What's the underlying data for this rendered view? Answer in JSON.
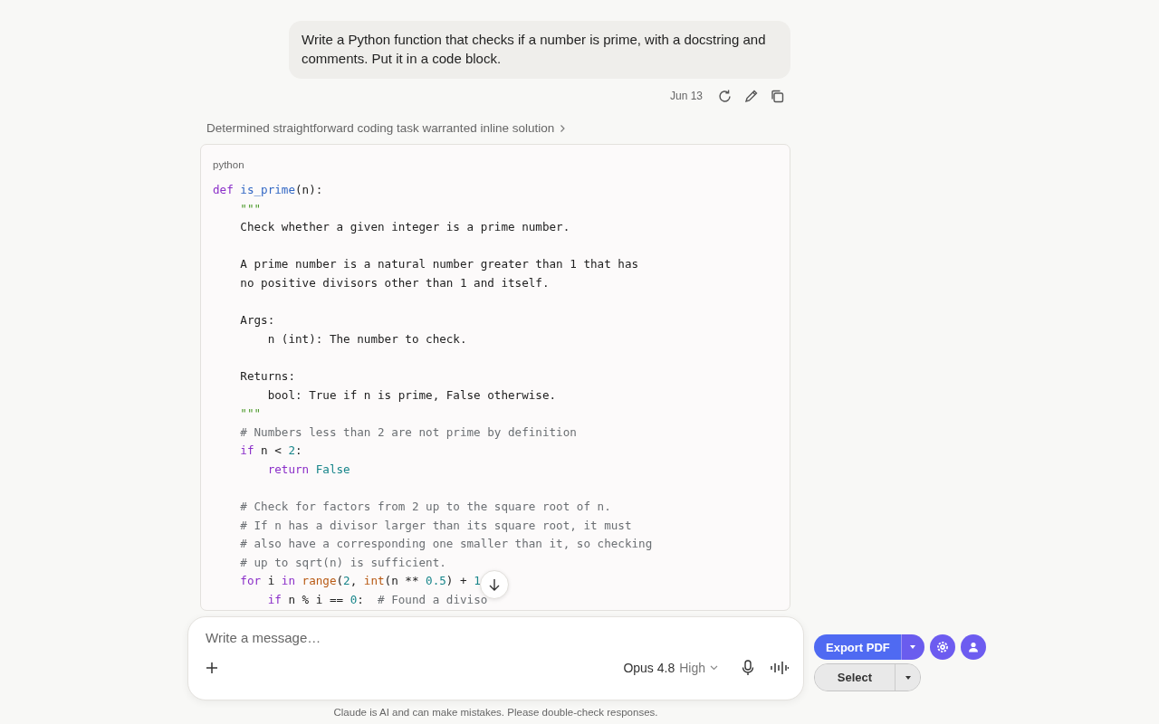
{
  "user_message": {
    "text": "Write a Python function that checks if a number is prime, with a docstring and comments. Put it in a code block.",
    "date": "Jun 13"
  },
  "thinking_summary": "Determined straightforward coding task warranted inline solution",
  "code_block": {
    "language": "python",
    "lines": [
      {
        "kind": "code",
        "tokens": [
          {
            "kind": "keyword",
            "text": "def "
          },
          {
            "kind": "function",
            "text": "is_prime"
          },
          {
            "kind": "plain",
            "text": "(n):"
          }
        ]
      },
      {
        "kind": "code",
        "tokens": [
          {
            "kind": "string",
            "text": "    \"\"\""
          }
        ]
      },
      {
        "kind": "code",
        "tokens": [
          {
            "kind": "plain",
            "text": "    Check whether a given integer is a prime number."
          }
        ]
      },
      {
        "kind": "blank"
      },
      {
        "kind": "code",
        "tokens": [
          {
            "kind": "plain",
            "text": "    A prime number is a natural number greater than 1 that has"
          }
        ]
      },
      {
        "kind": "code",
        "tokens": [
          {
            "kind": "plain",
            "text": "    no positive divisors other than 1 and itself."
          }
        ]
      },
      {
        "kind": "blank"
      },
      {
        "kind": "code",
        "tokens": [
          {
            "kind": "plain",
            "text": "    Args:"
          }
        ]
      },
      {
        "kind": "code",
        "tokens": [
          {
            "kind": "plain",
            "text": "        n (int): The number to check."
          }
        ]
      },
      {
        "kind": "blank"
      },
      {
        "kind": "code",
        "tokens": [
          {
            "kind": "plain",
            "text": "    Returns:"
          }
        ]
      },
      {
        "kind": "code",
        "tokens": [
          {
            "kind": "plain",
            "text": "        bool: True if n is prime, False otherwise."
          }
        ]
      },
      {
        "kind": "code",
        "tokens": [
          {
            "kind": "string",
            "text": "    \"\"\""
          }
        ]
      },
      {
        "kind": "code",
        "tokens": [
          {
            "kind": "comment",
            "text": "    # Numbers less than 2 are not prime by definition"
          }
        ]
      },
      {
        "kind": "code",
        "tokens": [
          {
            "kind": "keyword",
            "text": "    if"
          },
          {
            "kind": "plain",
            "text": " n < "
          },
          {
            "kind": "number",
            "text": "2"
          },
          {
            "kind": "plain",
            "text": ":"
          }
        ]
      },
      {
        "kind": "code",
        "tokens": [
          {
            "kind": "keyword",
            "text": "        return "
          },
          {
            "kind": "number",
            "text": "False"
          }
        ]
      },
      {
        "kind": "blank"
      },
      {
        "kind": "code",
        "tokens": [
          {
            "kind": "comment",
            "text": "    # Check for factors from 2 up to the square root of n."
          }
        ]
      },
      {
        "kind": "code",
        "tokens": [
          {
            "kind": "comment",
            "text": "    # If n has a divisor larger than its square root, it must"
          }
        ]
      },
      {
        "kind": "code",
        "tokens": [
          {
            "kind": "comment",
            "text": "    # also have a corresponding one smaller than it, so checking"
          }
        ]
      },
      {
        "kind": "code",
        "tokens": [
          {
            "kind": "comment",
            "text": "    # up to sqrt(n) is sufficient."
          }
        ]
      },
      {
        "kind": "code",
        "tokens": [
          {
            "kind": "keyword",
            "text": "    for"
          },
          {
            "kind": "plain",
            "text": " i "
          },
          {
            "kind": "keyword",
            "text": "in "
          },
          {
            "kind": "builtin",
            "text": "range"
          },
          {
            "kind": "plain",
            "text": "("
          },
          {
            "kind": "number",
            "text": "2"
          },
          {
            "kind": "plain",
            "text": ", "
          },
          {
            "kind": "builtin",
            "text": "int"
          },
          {
            "kind": "plain",
            "text": "(n ** "
          },
          {
            "kind": "number",
            "text": "0.5"
          },
          {
            "kind": "plain",
            "text": ") + "
          },
          {
            "kind": "number",
            "text": "1"
          }
        ]
      },
      {
        "kind": "code",
        "tokens": [
          {
            "kind": "keyword",
            "text": "        if"
          },
          {
            "kind": "plain",
            "text": " n % i == "
          },
          {
            "kind": "number",
            "text": "0"
          },
          {
            "kind": "plain",
            "text": ":  "
          },
          {
            "kind": "comment",
            "text": "# Found a diviso"
          }
        ]
      }
    ]
  },
  "composer": {
    "placeholder": "Write a message…",
    "model": "Opus 4.8",
    "effort": "High"
  },
  "disclaimer": "Claude is AI and can make mistakes. Please double-check responses.",
  "toolbar": {
    "export_label": "Export PDF",
    "select_label": "Select"
  }
}
